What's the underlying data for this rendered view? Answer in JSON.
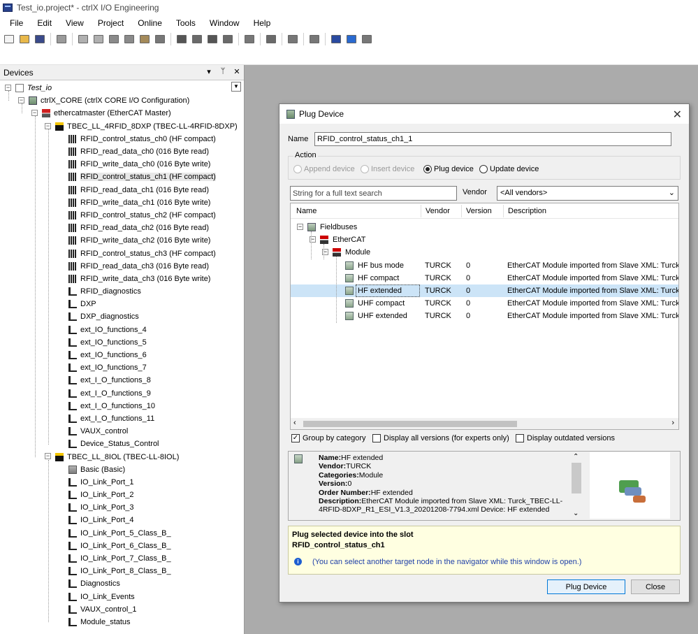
{
  "window": {
    "title": "Test_io.project* - ctrlX I/O Engineering"
  },
  "menu": [
    "File",
    "Edit",
    "View",
    "Project",
    "Online",
    "Tools",
    "Window",
    "Help"
  ],
  "toolbar": [
    {
      "icon": "new-icon",
      "color": "#f4f4f4"
    },
    {
      "icon": "open-icon",
      "color": "#e8b84a"
    },
    {
      "icon": "save-icon",
      "color": "#3a4a8a"
    },
    {
      "sep": true
    },
    {
      "icon": "print-icon",
      "color": "#9a9a9a"
    },
    {
      "sep": true
    },
    {
      "icon": "undo-icon",
      "color": "#b0b0b0"
    },
    {
      "icon": "redo-icon",
      "color": "#b0b0b0"
    },
    {
      "icon": "cut-icon",
      "color": "#8a8a8a"
    },
    {
      "icon": "copy-icon",
      "color": "#8a8a8a"
    },
    {
      "icon": "paste-icon",
      "color": "#a48a5a"
    },
    {
      "icon": "delete-icon",
      "color": "#777777"
    },
    {
      "sep": true
    },
    {
      "icon": "find-icon",
      "color": "#555555"
    },
    {
      "icon": "find-next-icon",
      "color": "#6a6a6a"
    },
    {
      "icon": "find-replace-icon",
      "color": "#555555"
    },
    {
      "icon": "find-all-icon",
      "color": "#6a6a6a"
    },
    {
      "sep": true
    },
    {
      "icon": "clipboard-icon",
      "color": "#777777"
    },
    {
      "sep": true
    },
    {
      "icon": "export-icon",
      "color": "#6a6a6a"
    },
    {
      "sep": true
    },
    {
      "icon": "filter-icon",
      "color": "#777777"
    },
    {
      "sep": true
    },
    {
      "icon": "check-icon",
      "color": "#777777"
    },
    {
      "sep": true
    },
    {
      "icon": "scan-icon",
      "color": "#2a4aa0"
    },
    {
      "icon": "download-icon",
      "color": "#2a6ad0"
    },
    {
      "icon": "copy-device-icon",
      "color": "#777777"
    }
  ],
  "devices_panel": {
    "title": "Devices",
    "header_buttons": [
      "▾",
      "ᛘ",
      "✕"
    ],
    "tree": [
      {
        "label": "Test_io",
        "level": 0,
        "icon": "project",
        "italic": true,
        "exp": "−"
      },
      {
        "label": "ctrlX_CORE (ctrlX CORE I/O Configuration)",
        "level": 1,
        "icon": "core",
        "exp": "−"
      },
      {
        "label": "ethercatmaster (EtherCAT Master)",
        "level": 2,
        "icon": "ecat",
        "exp": "−"
      },
      {
        "label": "TBEC_LL_4RFID_8DXP (TBEC-LL-4RFID-8DXP)",
        "level": 3,
        "icon": "tbec",
        "exp": "−"
      },
      {
        "label": "RFID_control_status_ch0 (HF compact)",
        "level": 4,
        "icon": "mod"
      },
      {
        "label": "RFID_read_data_ch0 (016 Byte read)",
        "level": 4,
        "icon": "mod"
      },
      {
        "label": "RFID_write_data_ch0 (016 Byte write)",
        "level": 4,
        "icon": "mod"
      },
      {
        "label": "RFID_control_status_ch1 (HF compact)",
        "level": 4,
        "icon": "mod",
        "selected": true
      },
      {
        "label": "RFID_read_data_ch1 (016 Byte read)",
        "level": 4,
        "icon": "mod"
      },
      {
        "label": "RFID_write_data_ch1 (016 Byte write)",
        "level": 4,
        "icon": "mod"
      },
      {
        "label": "RFID_control_status_ch2 (HF compact)",
        "level": 4,
        "icon": "mod"
      },
      {
        "label": "RFID_read_data_ch2 (016 Byte read)",
        "level": 4,
        "icon": "mod"
      },
      {
        "label": "RFID_write_data_ch2 (016 Byte write)",
        "level": 4,
        "icon": "mod"
      },
      {
        "label": "RFID_control_status_ch3 (HF compact)",
        "level": 4,
        "icon": "mod"
      },
      {
        "label": "RFID_read_data_ch3 (016 Byte read)",
        "level": 4,
        "icon": "mod"
      },
      {
        "label": "RFID_write_data_ch3 (016 Byte write)",
        "level": 4,
        "icon": "mod"
      },
      {
        "label": "RFID_diagnostics",
        "level": 4,
        "icon": "diag"
      },
      {
        "label": "DXP",
        "level": 4,
        "icon": "diag"
      },
      {
        "label": "DXP_diagnostics",
        "level": 4,
        "icon": "diag"
      },
      {
        "label": "ext_IO_functions_4",
        "level": 4,
        "icon": "diag"
      },
      {
        "label": "ext_IO_functions_5",
        "level": 4,
        "icon": "diag"
      },
      {
        "label": "ext_IO_functions_6",
        "level": 4,
        "icon": "diag"
      },
      {
        "label": "ext_IO_functions_7",
        "level": 4,
        "icon": "diag"
      },
      {
        "label": "ext_I_O_functions_8",
        "level": 4,
        "icon": "diag"
      },
      {
        "label": "ext_I_O_functions_9",
        "level": 4,
        "icon": "diag"
      },
      {
        "label": "ext_I_O_functions_10",
        "level": 4,
        "icon": "diag"
      },
      {
        "label": "ext_I_O_functions_11",
        "level": 4,
        "icon": "diag"
      },
      {
        "label": "VAUX_control",
        "level": 4,
        "icon": "diag"
      },
      {
        "label": "Device_Status_Control",
        "level": 4,
        "icon": "diag"
      },
      {
        "label": "TBEC_LL_8IOL (TBEC-LL-8IOL)",
        "level": 3,
        "icon": "tbec",
        "exp": "−"
      },
      {
        "label": "Basic (Basic)",
        "level": 4,
        "icon": "basic"
      },
      {
        "label": "IO_Link_Port_1",
        "level": 4,
        "icon": "diag"
      },
      {
        "label": "IO_Link_Port_2",
        "level": 4,
        "icon": "diag"
      },
      {
        "label": "IO_Link_Port_3",
        "level": 4,
        "icon": "diag"
      },
      {
        "label": "IO_Link_Port_4",
        "level": 4,
        "icon": "diag"
      },
      {
        "label": "IO_Link_Port_5_Class_B_",
        "level": 4,
        "icon": "diag"
      },
      {
        "label": "IO_Link_Port_6_Class_B_",
        "level": 4,
        "icon": "diag"
      },
      {
        "label": "IO_Link_Port_7_Class_B_",
        "level": 4,
        "icon": "diag"
      },
      {
        "label": "IO_Link_Port_8_Class_B_",
        "level": 4,
        "icon": "diag"
      },
      {
        "label": "Diagnostics",
        "level": 4,
        "icon": "diag"
      },
      {
        "label": "IO_Link_Events",
        "level": 4,
        "icon": "diag"
      },
      {
        "label": "VAUX_control_1",
        "level": 4,
        "icon": "diag"
      },
      {
        "label": "Module_status",
        "level": 4,
        "icon": "diag"
      }
    ]
  },
  "dialog": {
    "title": "Plug Device",
    "name_label": "Name",
    "name_value": "RFID_control_status_ch1_1",
    "action_label": "Action",
    "actions": [
      {
        "label": "Append device",
        "enabled": false,
        "checked": false
      },
      {
        "label": "Insert device",
        "enabled": false,
        "checked": false
      },
      {
        "label": "Plug device",
        "enabled": true,
        "checked": true
      },
      {
        "label": "Update device",
        "enabled": true,
        "checked": false
      }
    ],
    "search_placeholder": "String for a full text search",
    "vendor_label": "Vendor",
    "vendor_value": "<All vendors>",
    "columns": [
      "Name",
      "Vendor",
      "Version",
      "Description"
    ],
    "list": [
      {
        "name": "Fieldbuses",
        "depth": 0,
        "icon": "folder",
        "exp": "−"
      },
      {
        "name": "EtherCAT",
        "depth": 1,
        "icon": "ecat",
        "exp": "−"
      },
      {
        "name": "Module",
        "depth": 2,
        "icon": "ecat",
        "exp": "−"
      },
      {
        "name": "HF bus mode",
        "depth": 3,
        "icon": "mod",
        "vendor": "TURCK",
        "version": "0",
        "description": "EtherCAT Module imported from Slave XML: Turck_TE"
      },
      {
        "name": "HF compact",
        "depth": 3,
        "icon": "mod",
        "vendor": "TURCK",
        "version": "0",
        "description": "EtherCAT Module imported from Slave XML: Turck_TE"
      },
      {
        "name": "HF extended",
        "depth": 3,
        "icon": "mod",
        "vendor": "TURCK",
        "version": "0",
        "description": "EtherCAT Module imported from Slave XML: Turck_TE",
        "selected": true
      },
      {
        "name": "UHF compact",
        "depth": 3,
        "icon": "mod",
        "vendor": "TURCK",
        "version": "0",
        "description": "EtherCAT Module imported from Slave XML: Turck_TE"
      },
      {
        "name": "UHF extended",
        "depth": 3,
        "icon": "mod",
        "vendor": "TURCK",
        "version": "0",
        "description": "EtherCAT Module imported from Slave XML: Turck_TE"
      }
    ],
    "checkboxes": [
      {
        "label": "Group by category",
        "checked": true
      },
      {
        "label": "Display all versions (for experts only)",
        "checked": false
      },
      {
        "label": "Display outdated versions",
        "checked": false
      }
    ],
    "info": {
      "name_key": "Name:",
      "name": "HF extended",
      "vendor_key": "Vendor:",
      "vendor": "TURCK",
      "categories_key": "Categories:",
      "categories": "Module",
      "version_key": "Version:",
      "version": "0",
      "order_key": "Order Number:",
      "order": "HF extended",
      "description_key": "Description:",
      "description": "EtherCAT Module imported from Slave XML: Turck_TBEC-LL-4RFID-8DXP_R1_ESI_V1.3_20201208-7794.xml Device: HF extended"
    },
    "hint": {
      "line1": "Plug selected device into the slot",
      "line2": "RFID_control_status_ch1",
      "line3": "(You can select another target node in the navigator while this window is open.)"
    },
    "buttons": {
      "plug": "Plug Device",
      "close": "Close"
    }
  }
}
